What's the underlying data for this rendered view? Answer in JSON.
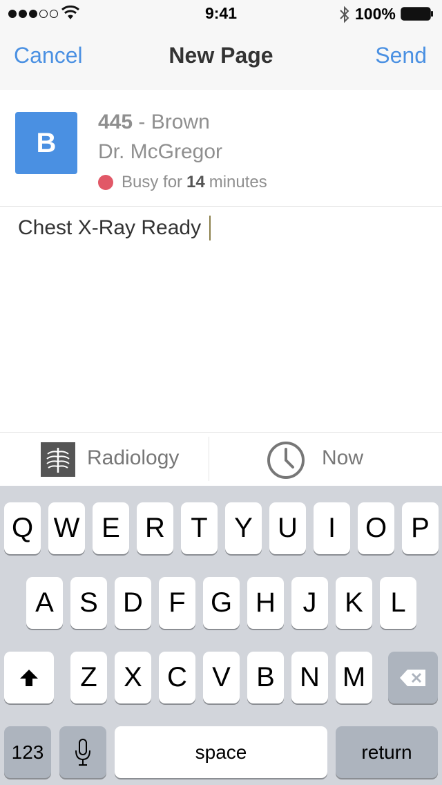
{
  "status_bar": {
    "time": "9:41",
    "battery_percent": "100%",
    "signal_bars_filled": 3,
    "signal_bars_total": 5
  },
  "navbar": {
    "cancel": "Cancel",
    "title": "New Page",
    "send": "Send"
  },
  "recipient": {
    "avatar_initial": "B",
    "room": "445",
    "separator": " - ",
    "patient": "Brown",
    "doctor": "Dr. McGregor",
    "status_prefix": "Busy for",
    "status_minutes": "14",
    "status_suffix": "minutes",
    "status_color": "#e15867"
  },
  "message": {
    "text": "Chest X-Ray Ready"
  },
  "options": {
    "department_label": "Radiology",
    "time_label": "Now"
  },
  "keyboard": {
    "row1": [
      "Q",
      "W",
      "E",
      "R",
      "T",
      "Y",
      "U",
      "I",
      "O",
      "P"
    ],
    "row2": [
      "A",
      "S",
      "D",
      "F",
      "G",
      "H",
      "J",
      "K",
      "L"
    ],
    "row3": [
      "Z",
      "X",
      "C",
      "V",
      "B",
      "N",
      "M"
    ],
    "numbers": "123",
    "space": "space",
    "return": "return"
  },
  "colors": {
    "accent": "#4a90e2",
    "keyboard_bg": "#d2d5db"
  }
}
